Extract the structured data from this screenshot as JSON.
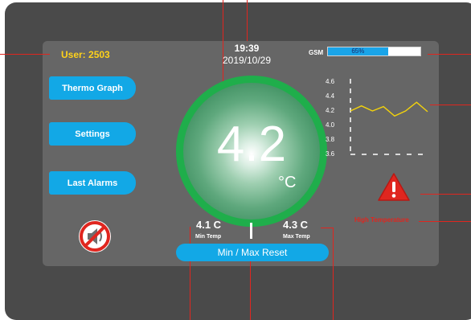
{
  "header": {
    "user": "User: 2503",
    "time": "19:39",
    "date": "2019/10/29",
    "gsm_label": "GSM",
    "gsm_signal": "65%",
    "gsm_signal_fraction": 0.65
  },
  "menu": {
    "items": [
      {
        "label": "Thermo Graph"
      },
      {
        "label": "Settings"
      },
      {
        "label": "Last Alarms"
      }
    ]
  },
  "reading": {
    "value": "4.2",
    "unit": "°C",
    "min_value": "4.1 C",
    "min_label": "Min Temp",
    "max_value": "4.3 C",
    "max_label": "Max Temp",
    "reset_label": "Min / Max Reset"
  },
  "alarm": {
    "text": "High Temperature"
  },
  "colors": {
    "accent_blue": "#12a8e6",
    "dial_green": "#1fae4b",
    "user_yellow": "#ffd21a",
    "graph_line": "#f2d20c",
    "alarm_red": "#e0261f"
  },
  "icons": {
    "mute": "speaker-muted-icon",
    "alarm": "warning-triangle-icon"
  },
  "chart_data": {
    "type": "line",
    "y_ticks": [
      "4.6",
      "4.4",
      "4.2",
      "4.0",
      "3.8",
      "3.6"
    ],
    "ylim": [
      3.6,
      4.6
    ],
    "values": [
      4.2,
      4.27,
      4.2,
      4.26,
      4.13,
      4.2,
      4.32,
      4.19
    ],
    "threshold": 3.6,
    "grid": false
  }
}
